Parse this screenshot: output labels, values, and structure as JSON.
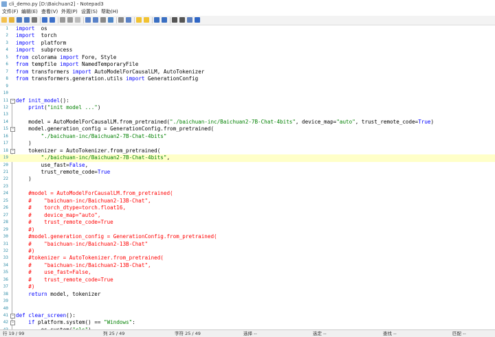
{
  "window": {
    "title": "cli_demo.py [D:\\Baichuan2] - Notepad3"
  },
  "menu": [
    "文件(F)",
    "编辑(E)",
    "查看(V)",
    "外观(P)",
    "设置(S)",
    "帮助(H)"
  ],
  "toolbar_icons": [
    "new-icon",
    "open-icon",
    "save-icon",
    "save-as-icon",
    "print-icon",
    "undo-icon",
    "redo-icon",
    "cut-icon",
    "copy-icon",
    "paste-icon",
    "find-icon",
    "replace-icon",
    "wrap-icon",
    "word-wrap-icon",
    "column-icon",
    "find-next-icon",
    "star-icon",
    "star-add-icon",
    "zoom-in-icon",
    "zoom-out-icon",
    "screen-icon",
    "fullscreen-icon",
    "properties-icon",
    "close-icon"
  ],
  "lines": [
    {
      "n": "1",
      "fold": "",
      "html": [
        [
          "kw",
          "import"
        ],
        [
          "",
          "  os"
        ]
      ]
    },
    {
      "n": "2",
      "fold": "",
      "html": [
        [
          "kw",
          "import"
        ],
        [
          "",
          "  torch"
        ]
      ]
    },
    {
      "n": "3",
      "fold": "",
      "html": [
        [
          "kw",
          "import"
        ],
        [
          "",
          "  platform"
        ]
      ]
    },
    {
      "n": "4",
      "fold": "",
      "html": [
        [
          "kw",
          "import"
        ],
        [
          "",
          "  subprocess"
        ]
      ]
    },
    {
      "n": "5",
      "fold": "",
      "html": [
        [
          "kw",
          "from"
        ],
        [
          "",
          " colorama "
        ],
        [
          "kw",
          "import"
        ],
        [
          "",
          " Fore, Style"
        ]
      ]
    },
    {
      "n": "6",
      "fold": "",
      "html": [
        [
          "kw",
          "from"
        ],
        [
          "",
          " tempfile "
        ],
        [
          "kw",
          "import"
        ],
        [
          "",
          " NamedTemporaryFile"
        ]
      ]
    },
    {
      "n": "7",
      "fold": "",
      "html": [
        [
          "kw",
          "from"
        ],
        [
          "",
          " transformers "
        ],
        [
          "kw",
          "import"
        ],
        [
          "",
          " AutoModelForCausalLM, AutoTokenizer"
        ]
      ]
    },
    {
      "n": "8",
      "fold": "",
      "html": [
        [
          "kw",
          "from"
        ],
        [
          "",
          " transformers.generation.utils "
        ],
        [
          "kw",
          "import"
        ],
        [
          "",
          " GenerationConfig"
        ]
      ]
    },
    {
      "n": "9",
      "fold": "",
      "html": []
    },
    {
      "n": "10",
      "fold": "",
      "html": []
    },
    {
      "n": "11",
      "fold": "minus",
      "html": [
        [
          "kw",
          "def"
        ],
        [
          "",
          " "
        ],
        [
          "fn",
          "init_model"
        ],
        [
          "",
          "():"
        ]
      ]
    },
    {
      "n": "12",
      "fold": "",
      "html": [
        [
          "",
          "    "
        ],
        [
          "kw",
          "print"
        ],
        [
          "",
          "("
        ],
        [
          "str",
          "\"init model ...\""
        ],
        [
          "",
          ")"
        ]
      ]
    },
    {
      "n": "13",
      "fold": "",
      "html": []
    },
    {
      "n": "14",
      "fold": "",
      "html": [
        [
          "",
          "    model = AutoModelForCausalLM.from_pretrained("
        ],
        [
          "str",
          "\"./baichuan-inc/Baichuan2-7B-Chat-4bits\""
        ],
        [
          "",
          ", device_map="
        ],
        [
          "str",
          "\"auto\""
        ],
        [
          "",
          ", trust_remote_code="
        ],
        [
          "kw",
          "True"
        ],
        [
          "",
          ")"
        ]
      ]
    },
    {
      "n": "15",
      "fold": "minus",
      "html": [
        [
          "",
          "    model.generation_config = GenerationConfig.from_pretrained("
        ]
      ]
    },
    {
      "n": "16",
      "fold": "",
      "html": [
        [
          "",
          "        "
        ],
        [
          "str",
          "\"./baichuan-inc/Baichuan2-7B-Chat-4bits\""
        ]
      ]
    },
    {
      "n": "17",
      "fold": "",
      "html": [
        [
          "",
          "    )"
        ]
      ]
    },
    {
      "n": "18",
      "fold": "minus",
      "html": [
        [
          "",
          "    tokenizer = AutoTokenizer.from_pretrained("
        ]
      ]
    },
    {
      "n": "19",
      "fold": "",
      "cur": true,
      "html": [
        [
          "",
          "        "
        ],
        [
          "str",
          "\"./baichuan-inc/Baichuan2-7B-Chat-4bits\""
        ],
        [
          "",
          ","
        ]
      ]
    },
    {
      "n": "20",
      "fold": "",
      "html": [
        [
          "",
          "        use_fast="
        ],
        [
          "kw",
          "False"
        ],
        [
          "",
          ","
        ]
      ]
    },
    {
      "n": "21",
      "fold": "",
      "html": [
        [
          "",
          "        trust_remote_code="
        ],
        [
          "kw",
          "True"
        ]
      ]
    },
    {
      "n": "22",
      "fold": "",
      "html": [
        [
          "",
          "    )"
        ]
      ]
    },
    {
      "n": "23",
      "fold": "",
      "html": []
    },
    {
      "n": "24",
      "fold": "",
      "html": [
        [
          "cm",
          "    #model = AutoModelForCausalLM.from_pretrained("
        ]
      ]
    },
    {
      "n": "25",
      "fold": "",
      "html": [
        [
          "cm",
          "    #    \"baichuan-inc/Baichuan2-13B-Chat\","
        ]
      ]
    },
    {
      "n": "26",
      "fold": "",
      "html": [
        [
          "cm",
          "    #    torch_dtype=torch.float16,"
        ]
      ]
    },
    {
      "n": "27",
      "fold": "",
      "html": [
        [
          "cm",
          "    #    device_map=\"auto\","
        ]
      ]
    },
    {
      "n": "28",
      "fold": "",
      "html": [
        [
          "cm",
          "    #    trust_remote_code=True"
        ]
      ]
    },
    {
      "n": "29",
      "fold": "",
      "html": [
        [
          "cm",
          "    #)"
        ]
      ]
    },
    {
      "n": "30",
      "fold": "",
      "html": [
        [
          "cm",
          "    #model.generation_config = GenerationConfig.from_pretrained("
        ]
      ]
    },
    {
      "n": "31",
      "fold": "",
      "html": [
        [
          "cm",
          "    #    \"baichuan-inc/Baichuan2-13B-Chat\""
        ]
      ]
    },
    {
      "n": "32",
      "fold": "",
      "html": [
        [
          "cm",
          "    #)"
        ]
      ]
    },
    {
      "n": "33",
      "fold": "",
      "html": [
        [
          "cm",
          "    #tokenizer = AutoTokenizer.from_pretrained("
        ]
      ]
    },
    {
      "n": "34",
      "fold": "",
      "html": [
        [
          "cm",
          "    #    \"baichuan-inc/Baichuan2-13B-Chat\","
        ]
      ]
    },
    {
      "n": "35",
      "fold": "",
      "html": [
        [
          "cm",
          "    #    use_fast=False,"
        ]
      ]
    },
    {
      "n": "36",
      "fold": "",
      "html": [
        [
          "cm",
          "    #    trust_remote_code=True"
        ]
      ]
    },
    {
      "n": "37",
      "fold": "",
      "html": [
        [
          "cm",
          "    #)"
        ]
      ]
    },
    {
      "n": "38",
      "fold": "",
      "html": [
        [
          "",
          "    "
        ],
        [
          "kw",
          "return"
        ],
        [
          "",
          " model, tokenizer"
        ]
      ]
    },
    {
      "n": "39",
      "fold": "",
      "html": []
    },
    {
      "n": "40",
      "fold": "",
      "html": []
    },
    {
      "n": "41",
      "fold": "minus",
      "html": [
        [
          "kw",
          "def"
        ],
        [
          "",
          " "
        ],
        [
          "fn",
          "clear_screen"
        ],
        [
          "",
          "():"
        ]
      ]
    },
    {
      "n": "42",
      "fold": "minus",
      "html": [
        [
          "",
          "    "
        ],
        [
          "kw",
          "if"
        ],
        [
          "",
          " platform.system() == "
        ],
        [
          "str",
          "\"Windows\""
        ],
        [
          "",
          ":"
        ]
      ]
    },
    {
      "n": "43",
      "fold": "",
      "html": [
        [
          "",
          "        os.system("
        ],
        [
          "str",
          "\"cls\""
        ],
        [
          "",
          ")"
        ]
      ]
    }
  ],
  "status": {
    "line": "行 19 / 99",
    "col": "列 25 / 49",
    "char": "字符 25 / 49",
    "sel": "选择 --",
    "sel_lines": "选定 --",
    "find": "查找 --",
    "match": "匹配 --"
  }
}
